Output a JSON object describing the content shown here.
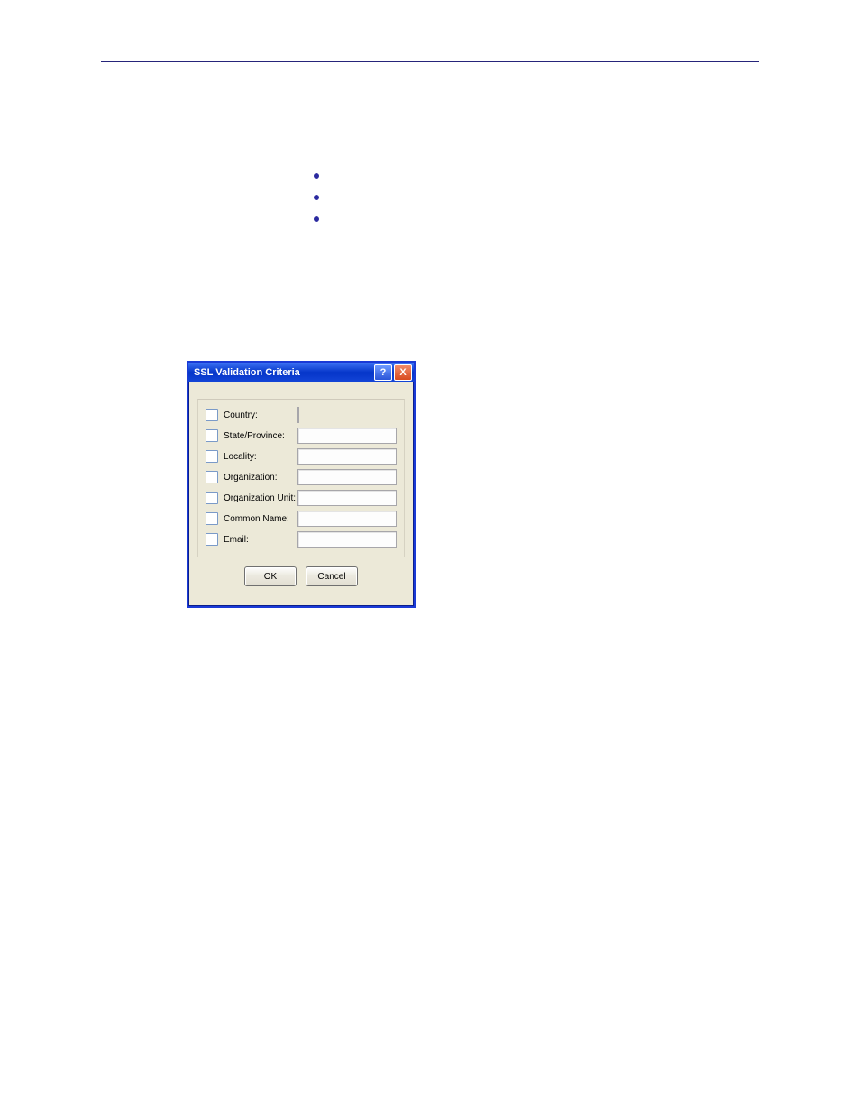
{
  "dialog": {
    "title": "SSL Validation Criteria",
    "fields": [
      {
        "label": "Country:",
        "short": true
      },
      {
        "label": "State/Province:",
        "short": false
      },
      {
        "label": "Locality:",
        "short": false
      },
      {
        "label": "Organization:",
        "short": false
      },
      {
        "label": "Organization Unit:",
        "short": false
      },
      {
        "label": "Common Name:",
        "short": false
      },
      {
        "label": "Email:",
        "short": false
      }
    ],
    "buttons": {
      "ok": "OK",
      "cancel": "Cancel"
    }
  },
  "titlebar": {
    "help": "?",
    "close": "X"
  }
}
